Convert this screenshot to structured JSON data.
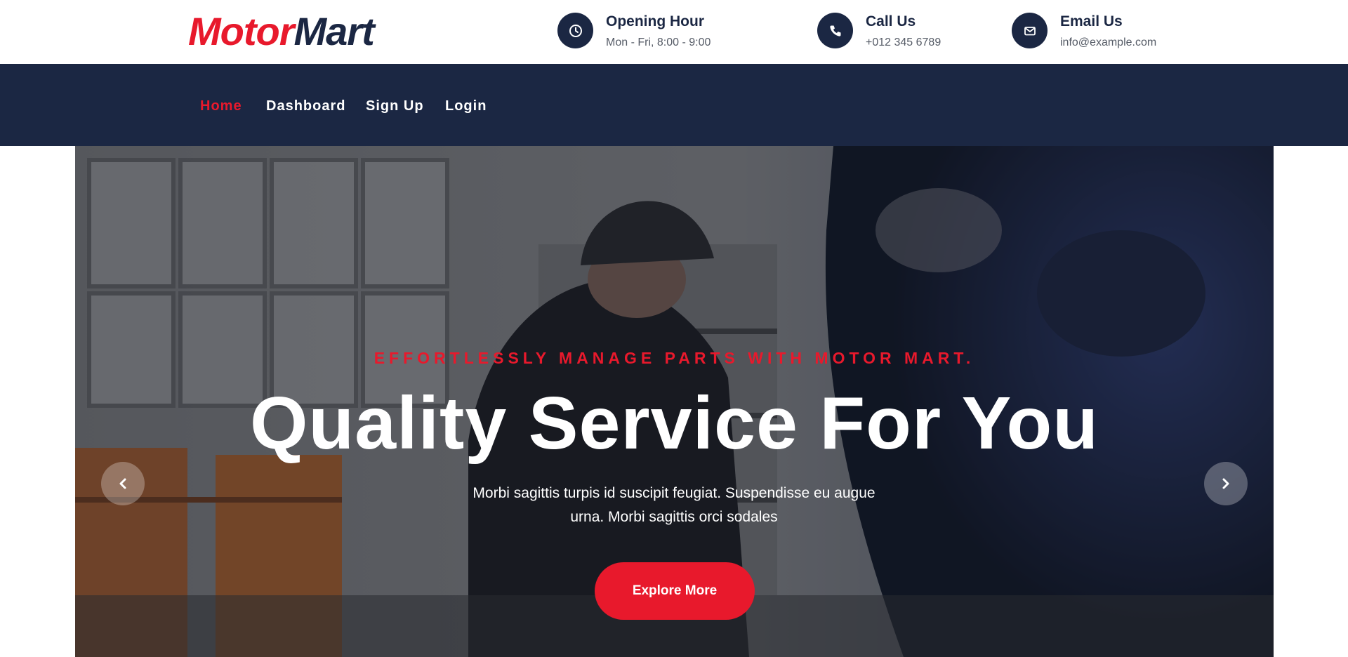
{
  "brand": {
    "part1": "Motor",
    "part2": "Mart"
  },
  "contact": {
    "hours": {
      "icon": "clock-icon",
      "title": "Opening Hour",
      "value": "Mon - Fri, 8:00 - 9:00"
    },
    "phone": {
      "icon": "phone-icon",
      "title": "Call Us",
      "value": "+012 345 6789"
    },
    "email": {
      "icon": "envelope-icon",
      "title": "Email Us",
      "value": "info@example.com"
    }
  },
  "nav": {
    "items": [
      {
        "label": "Home",
        "active": true
      },
      {
        "label": "Dashboard",
        "active": false
      },
      {
        "label": "Sign Up",
        "active": false
      },
      {
        "label": "Login",
        "active": false
      }
    ]
  },
  "hero": {
    "eyebrow": "EFFORTLESSLY MANAGE PARTS WITH MOTOR MART.",
    "title": "Quality Service For You",
    "description": "Morbi sagittis turpis id suscipit feugiat. Suspendisse eu augue urna. Morbi sagittis orci sodales",
    "cta_label": "Explore More",
    "prev_icon": "chevron-left-icon",
    "next_icon": "chevron-right-icon"
  },
  "colors": {
    "accent": "#e8192c",
    "navy": "#1b2743",
    "white": "#ffffff"
  }
}
